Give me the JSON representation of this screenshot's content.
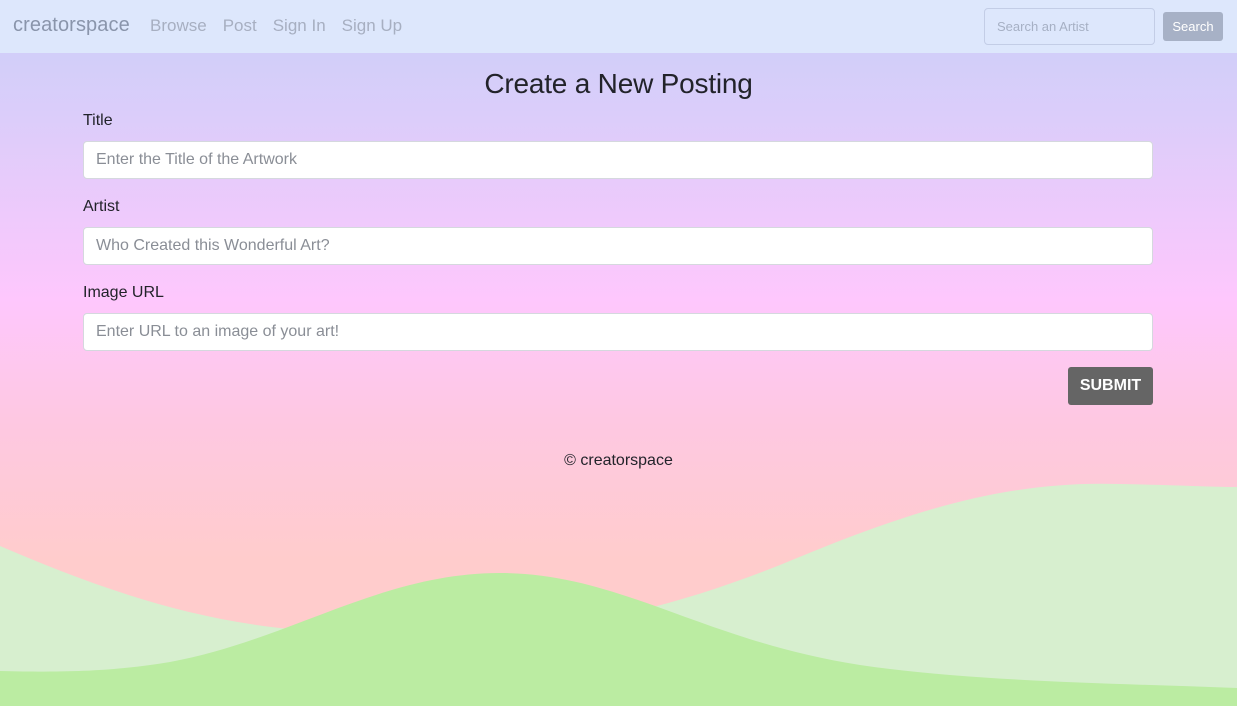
{
  "navbar": {
    "brand": "creatorspace",
    "links": [
      "Browse",
      "Post",
      "Sign In",
      "Sign Up"
    ],
    "search_placeholder": "Search an Artist",
    "search_button": "Search"
  },
  "form": {
    "title": "Create a New Posting",
    "fields": [
      {
        "label": "Title",
        "placeholder": "Enter the Title of the Artwork"
      },
      {
        "label": "Artist",
        "placeholder": "Who Created this Wonderful Art?"
      },
      {
        "label": "Image URL",
        "placeholder": "Enter URL to an image of your art!"
      }
    ],
    "submit_label": "SUBMIT"
  },
  "footer": {
    "text": "© creatorspace"
  },
  "colors": {
    "navbar_bg": "#dde7fc",
    "submit_bg": "#656565",
    "hill_light": "#d7efcf",
    "hill_dark": "#bbeca2"
  }
}
